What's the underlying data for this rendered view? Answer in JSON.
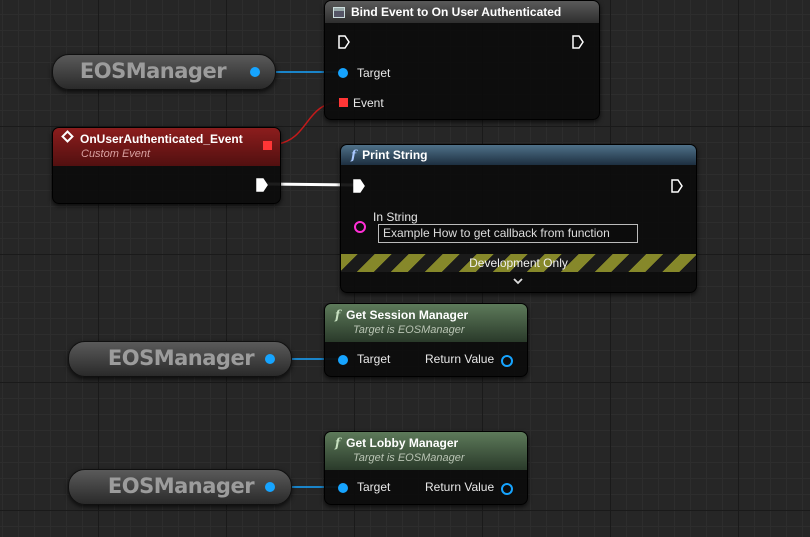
{
  "bind_node": {
    "title": "Bind Event to On User Authenticated",
    "pins": {
      "target": "Target",
      "event": "Event"
    }
  },
  "custom_event_node": {
    "title": "OnUserAuthenticated_Event",
    "subtitle": "Custom Event"
  },
  "print_string_node": {
    "title": "Print String",
    "in_string_label": "In String",
    "in_string_value": "Example How to get callback from function",
    "dev_only_label": "Development Only",
    "expand_icon": "chevron-down-icon"
  },
  "get_session_node": {
    "title": "Get Session Manager",
    "subtitle": "Target is EOSManager",
    "target_label": "Target",
    "return_label": "Return Value"
  },
  "get_lobby_node": {
    "title": "Get Lobby Manager",
    "subtitle": "Target is EOSManager",
    "target_label": "Target",
    "return_label": "Return Value"
  },
  "variables": [
    {
      "label": "EOSManager"
    },
    {
      "label": "EOSManager"
    },
    {
      "label": "EOSManager"
    }
  ],
  "colors": {
    "object_pin": "#16a4ff",
    "delegate_pin": "#ff3636",
    "string_pin": "#ff2fd6",
    "exec_wire": "#ffffff"
  }
}
